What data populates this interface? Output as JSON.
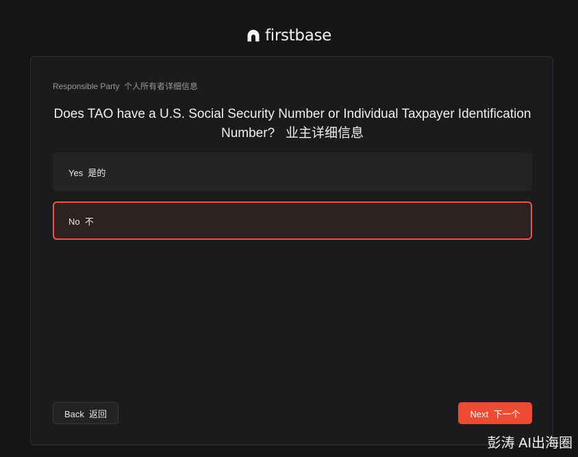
{
  "header": {
    "brand": "firstbase",
    "logo_icon": "firstbase-logo-icon"
  },
  "form": {
    "eyebrow": "Responsible Party  个人所有者详细信息",
    "question": "Does TAO have a U.S. Social Security Number or Individual Taxpayer Identification Number?   业主详细信息",
    "options": [
      {
        "label": "Yes  是的",
        "selected": false
      },
      {
        "label": "No  不",
        "selected": true
      }
    ],
    "back_label": "Back  返回",
    "next_label": "Next  下一个"
  },
  "watermark": "彭涛 AI出海圈",
  "colors": {
    "background": "#151516",
    "card": "#1b1b1d",
    "accent": "#ee4b34",
    "selected_border": "#e8574a",
    "selected_fill": "#2d2121"
  }
}
